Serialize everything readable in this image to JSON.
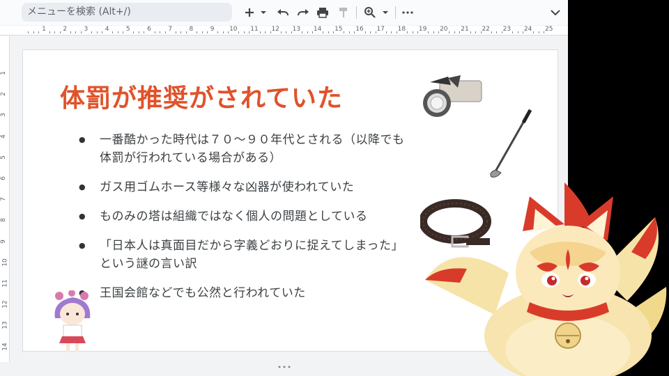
{
  "toolbar": {
    "search_placeholder": "メニューを検索 (Alt+/)",
    "icons": [
      "plus-icon",
      "chevron-down-icon",
      "undo-icon",
      "redo-icon",
      "print-icon",
      "paint-format-icon",
      "zoom-icon",
      "chevron-down-icon",
      "more-icon",
      "collapse-icon"
    ]
  },
  "ruler": {
    "horizontal": [
      "1",
      "2",
      "3",
      "4",
      "5",
      "6",
      "7",
      "8",
      "9",
      "10",
      "11",
      "12",
      "13",
      "14",
      "15",
      "16",
      "17",
      "18",
      "19",
      "20",
      "21",
      "22",
      "23",
      "24",
      "25"
    ],
    "vertical": [
      "1",
      "2",
      "3",
      "4",
      "5",
      "6",
      "7",
      "8",
      "9",
      "10",
      "11",
      "12",
      "13",
      "14"
    ]
  },
  "slide": {
    "title": "体罰が推奨がされていた",
    "bullets": [
      "一番酷かった時代は７０～９０年代とされる（以降でも体罰が行われている場合がある）",
      "ガス用ゴムホース等様々な凶器が使われていた",
      "ものみの塔は組織ではなく個人の問題としている",
      "「日本人は真面目だから字義どおりに捉えてしまった」という謎の言い訳",
      "王国会館などでも公然と行われていた"
    ],
    "title_color": "#e0522a"
  },
  "images": [
    "camera-illustration",
    "golf-club-illustration",
    "belt-illustration",
    "purple-hair-character-illustration",
    "fox-vtuber-avatar"
  ]
}
